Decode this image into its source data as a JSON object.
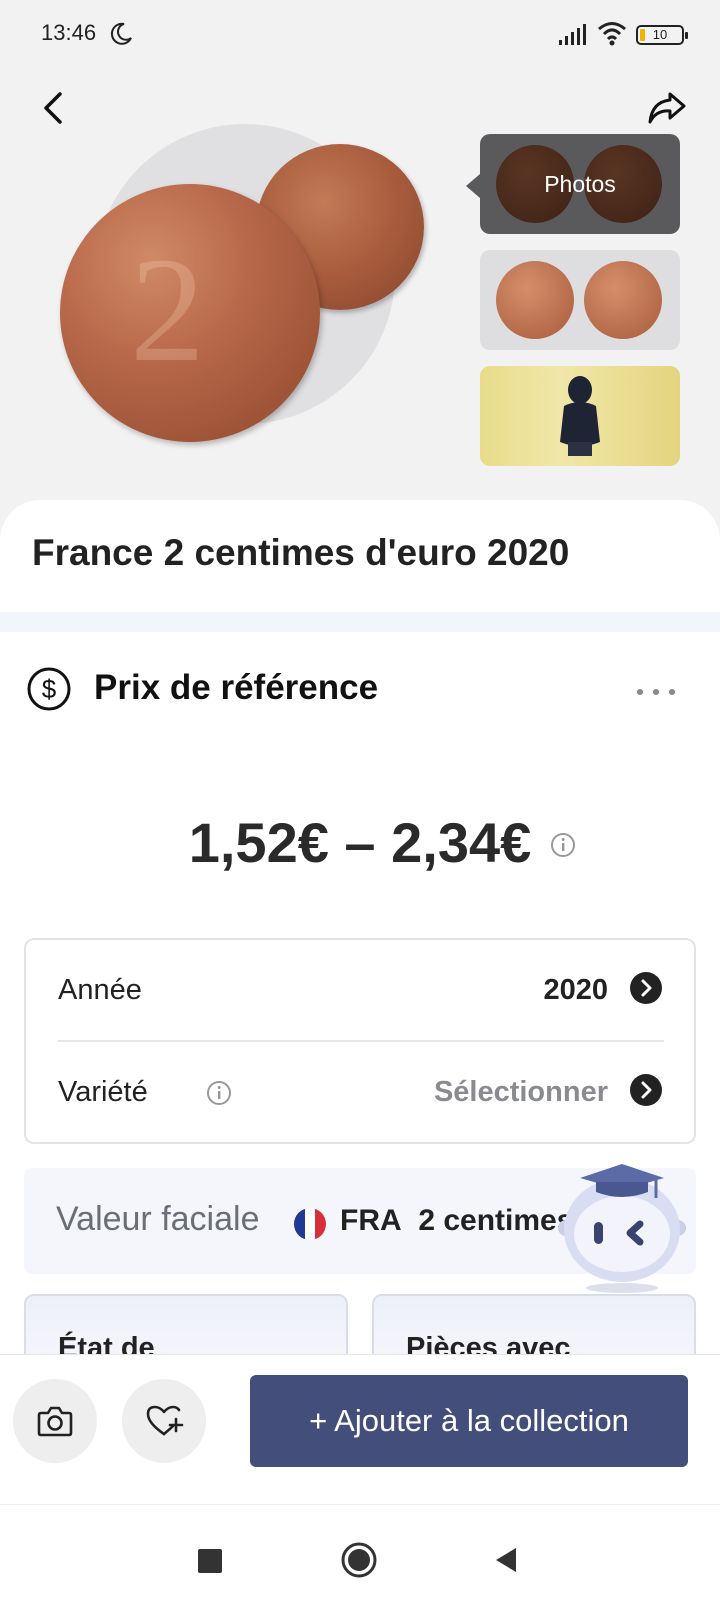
{
  "status_bar": {
    "time": "13:46",
    "battery": "10"
  },
  "gallery": {
    "photos_label": "Photos"
  },
  "coin": {
    "title": "France 2 centimes d'euro 2020"
  },
  "reference_price": {
    "title": "Prix de référence",
    "price_range": "1,52€ – 2,34€"
  },
  "details": {
    "year_label": "Année",
    "year_value": "2020",
    "variety_label": "Variété",
    "variety_value": "Sélectionner"
  },
  "face_value": {
    "label": "Valeur faciale",
    "country": "FRA",
    "value": "2 centimes"
  },
  "cards": {
    "condition": "État de",
    "pieces": "Pièces avec"
  },
  "actions": {
    "add_label": "+ Ajouter à la collection"
  },
  "colors": {
    "accent": "#434e7a",
    "background": "#f2f2f3"
  }
}
